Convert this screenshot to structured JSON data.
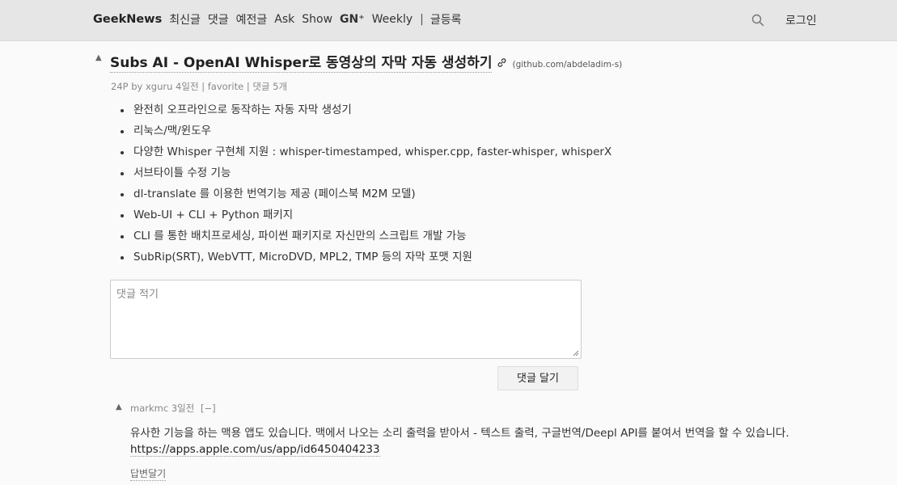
{
  "header": {
    "brand": "GeekNews",
    "nav": [
      {
        "label": "최신글"
      },
      {
        "label": "댓글"
      },
      {
        "label": "예전글"
      },
      {
        "label": "Ask"
      },
      {
        "label": "Show"
      },
      {
        "label": "GN⁺"
      },
      {
        "label": "Weekly"
      }
    ],
    "separator": "|",
    "nav_extra": "글등록",
    "login": "로그인",
    "search_icon": "search-icon"
  },
  "article": {
    "upvote_symbol": "▲",
    "title": "Subs AI - OpenAI Whisper로 동영상의 자막 자동 생성하기",
    "domain": "(github.com/abdeladim-s)",
    "meta": {
      "points_author_time": "24P by xguru 4일전",
      "sep": "|",
      "favorite": "favorite",
      "comments": "댓글 5개"
    },
    "bullets": [
      "완전히 오프라인으로 동작하는 자동 자막 생성기",
      "리눅스/맥/윈도우",
      "다양한 Whisper 구현체 지원 : whisper-timestamped, whisper.cpp, faster-whisper, whisperX",
      "서브타이틀 수정 기능",
      "dl-translate 를 이용한 번역기능 제공 (페이스북 M2M 모델)",
      "Web-UI + CLI + Python 패키지",
      "CLI 를 통한 배치프로세싱, 파이썬 패키지로 자신만의 스크립트 개발 가능",
      "SubRip(SRT), WebVTT, MicroDVD, MPL2, TMP 등의 자막 포맷 지원"
    ]
  },
  "comment_form": {
    "placeholder": "댓글 적기",
    "submit": "댓글 달기"
  },
  "comments": [
    {
      "upvote_symbol": "▲",
      "meta": "markmc 3일전",
      "toggle": "[−]",
      "text": "유사한 기능을 하는 맥용 앱도 있습니다. 맥에서 나오는 소리 출력을 받아서 - 텍스트 출력, 구글번역/Deepl API를 붙여서 번역을 할 수 있습니다.",
      "link": "https://apps.apple.com/us/app/id6450404233",
      "reply": "답변달기"
    }
  ]
}
